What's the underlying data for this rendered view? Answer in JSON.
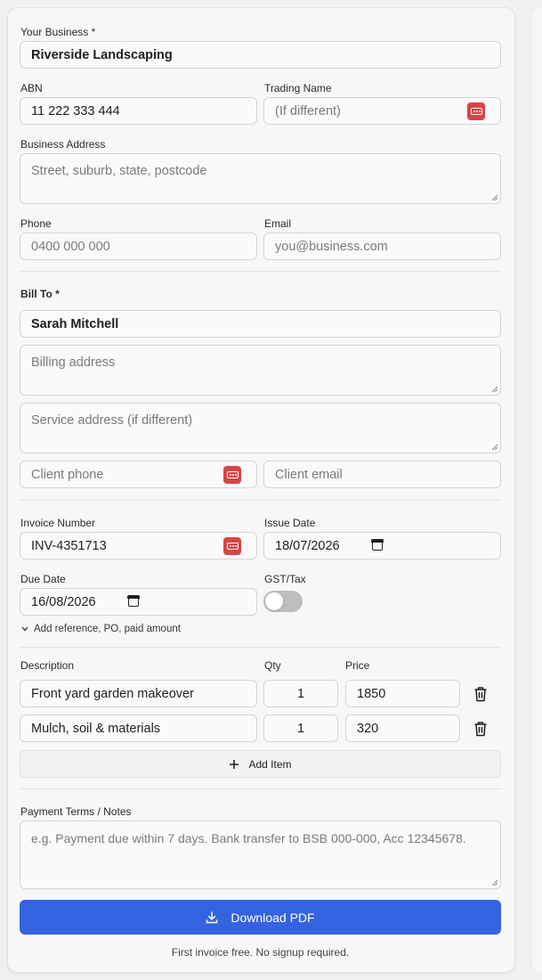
{
  "business": {
    "name_label": "Your Business *",
    "name_value": "Riverside Landscaping",
    "abn_label": "ABN",
    "abn_value": "11 222 333 444",
    "trading_label": "Trading Name",
    "trading_placeholder": "(If different)",
    "address_label": "Business Address",
    "address_placeholder": "Street, suburb, state, postcode",
    "phone_label": "Phone",
    "phone_placeholder": "0400 000 000",
    "email_label": "Email",
    "email_placeholder": "you@business.com"
  },
  "bill_to": {
    "label": "Bill To *",
    "name_value": "Sarah Mitchell",
    "billing_placeholder": "Billing address",
    "service_placeholder": "Service address (if different)",
    "phone_placeholder": "Client phone",
    "email_placeholder": "Client email"
  },
  "invoice": {
    "number_label": "Invoice Number",
    "number_value": "INV-4351713",
    "issue_label": "Issue Date",
    "issue_value": "18/07/2026",
    "due_label": "Due Date",
    "due_value": "16/08/2026",
    "gst_label": "GST/Tax",
    "gst_enabled": false,
    "more_toggle": "Add reference, PO, paid amount"
  },
  "items": {
    "desc_header": "Description",
    "qty_header": "Qty",
    "price_header": "Price",
    "rows": [
      {
        "description": "Front yard garden makeover",
        "qty": "1",
        "price": "1850"
      },
      {
        "description": "Mulch, soil & materials",
        "qty": "1",
        "price": "320"
      }
    ],
    "add_label": "Add Item"
  },
  "notes": {
    "label": "Payment Terms / Notes",
    "placeholder": "e.g. Payment due within 7 days. Bank transfer to BSB 000-000, Acc 12345678."
  },
  "actions": {
    "download_label": "Download PDF",
    "footnote": "First invoice free. No signup required."
  },
  "colors": {
    "primary": "#3563e0",
    "autofill_badge": "#d64545",
    "toggle_off": "#bdbdbd"
  }
}
